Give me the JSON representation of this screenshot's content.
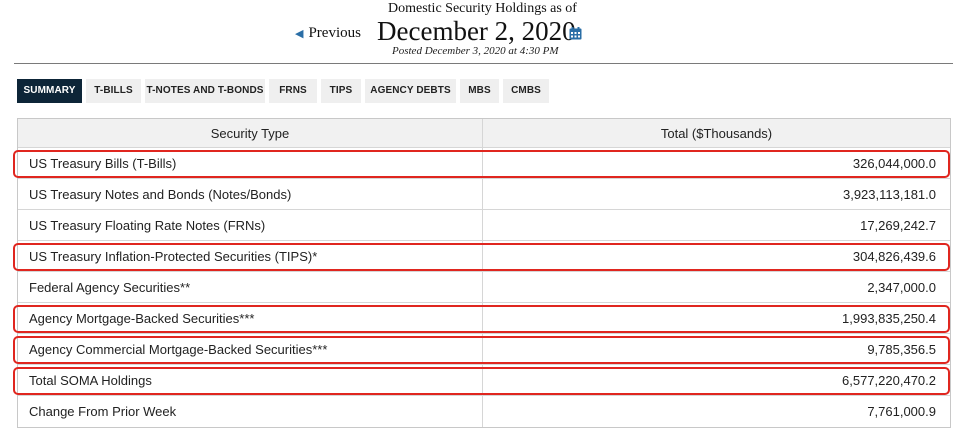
{
  "header": {
    "subtitle": "Domestic Security Holdings as of",
    "previous_label": "Previous",
    "date": "December 2, 2020",
    "posted": "Posted December 3, 2020 at 4:30 PM",
    "calendar_icon": "calendar-icon"
  },
  "tabs": [
    {
      "label": "SUMMARY",
      "active": true
    },
    {
      "label": "T-BILLS",
      "active": false
    },
    {
      "label": "T-NOTES AND T-BONDS",
      "active": false
    },
    {
      "label": "FRNS",
      "active": false
    },
    {
      "label": "TIPS",
      "active": false
    },
    {
      "label": "AGENCY DEBTS",
      "active": false
    },
    {
      "label": "MBS",
      "active": false
    },
    {
      "label": "CMBS",
      "active": false
    }
  ],
  "table": {
    "columns": [
      "Security Type",
      "Total ($Thousands)"
    ],
    "rows": [
      {
        "type": "US Treasury Bills (T-Bills)",
        "total": "326,044,000.0",
        "highlighted": true
      },
      {
        "type": "US Treasury Notes and Bonds (Notes/Bonds)",
        "total": "3,923,113,181.0",
        "highlighted": false
      },
      {
        "type": "US Treasury Floating Rate Notes (FRNs)",
        "total": "17,269,242.7",
        "highlighted": false
      },
      {
        "type": "US Treasury Inflation-Protected Securities (TIPS)*",
        "total": "304,826,439.6",
        "highlighted": true
      },
      {
        "type": "Federal Agency Securities**",
        "total": "2,347,000.0",
        "highlighted": false
      },
      {
        "type": "Agency Mortgage-Backed Securities***",
        "total": "1,993,835,250.4",
        "highlighted": true
      },
      {
        "type": "Agency Commercial Mortgage-Backed Securities***",
        "total": "9,785,356.5",
        "highlighted": true
      },
      {
        "type": "Total SOMA Holdings",
        "total": "6,577,220,470.2",
        "highlighted": true
      },
      {
        "type": "Change From Prior Week",
        "total": "7,761,000.9",
        "highlighted": false
      }
    ]
  },
  "colors": {
    "active_tab": "#0d2538",
    "tab_bg": "#efefef",
    "highlight": "#e0261f",
    "icon_blue": "#2a6ea6"
  }
}
